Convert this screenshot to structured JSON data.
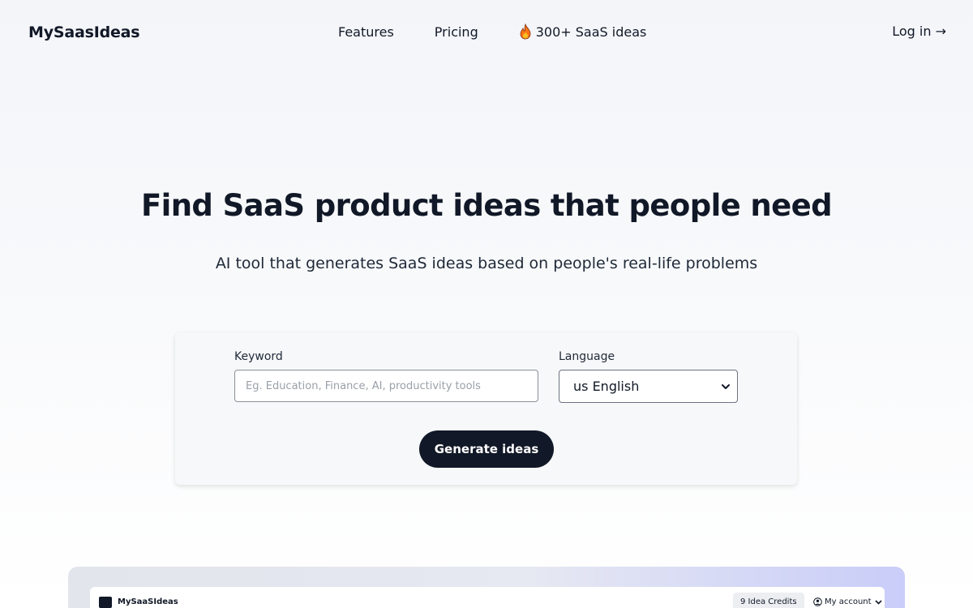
{
  "nav": {
    "logo": "MySaasIdeas",
    "links": [
      "Features",
      "Pricing"
    ],
    "ideas_link": "300+ SaaS ideas",
    "ideas_icon": "fire-icon",
    "login": "Log in →"
  },
  "hero": {
    "title": "Find SaaS product ideas that people need",
    "subtitle": "AI tool that generates SaaS ideas based on people's real-life problems"
  },
  "form": {
    "keyword_label": "Keyword",
    "keyword_placeholder": "Eg. Education, Finance, AI, productivity tools",
    "keyword_value": "",
    "language_label": "Language",
    "language_value": "us English",
    "generate_label": "Generate ideas"
  },
  "preview": {
    "logo": "MySaaSIdeas",
    "credits": "9 Idea Credits",
    "account": "My account"
  },
  "colors": {
    "primary": "#111827",
    "card_bg": "#f7f8fa",
    "accent_gradient_end": "#c9cdf8"
  }
}
